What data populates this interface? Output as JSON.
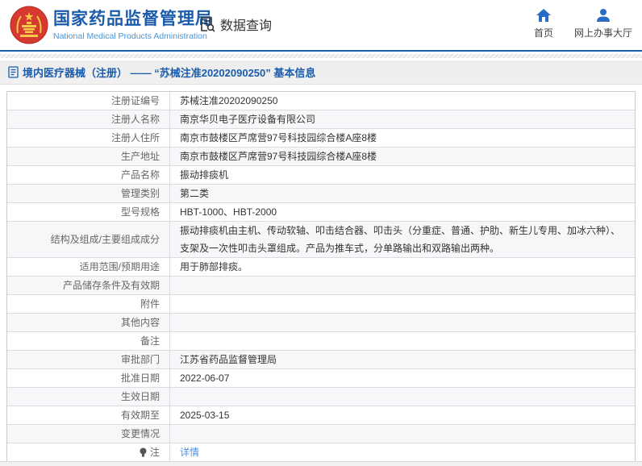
{
  "header": {
    "org_name_cn": "国家药品监督管理局",
    "org_name_en": "National Medical Products Administration",
    "data_query_label": "数据查询",
    "nav_home_label": "首页",
    "nav_hall_label": "网上办事大厅"
  },
  "breadcrumb": {
    "text": "境内医疗器械（注册） —— “苏械注准20202090250” 基本信息"
  },
  "colors": {
    "accent_blue": "#1a5cab",
    "icon_blue": "#2a6cc4",
    "link_blue": "#4a90e2",
    "emblem_red": "#d6392f",
    "emblem_gold": "#f7c948",
    "row_alt_bg": "#f7f7f9"
  },
  "table": {
    "rows": [
      {
        "label": "注册证编号",
        "value": "苏械注准20202090250"
      },
      {
        "label": "注册人名称",
        "value": "南京华贝电子医疗设备有限公司"
      },
      {
        "label": "注册人住所",
        "value": "南京市鼓楼区芦席营97号科技园综合楼A座8楼"
      },
      {
        "label": "生产地址",
        "value": "南京市鼓楼区芦席营97号科技园综合楼A座8楼"
      },
      {
        "label": "产品名称",
        "value": "振动排痰机"
      },
      {
        "label": "管理类别",
        "value": "第二类"
      },
      {
        "label": "型号规格",
        "value": "HBT-1000、HBT-2000"
      },
      {
        "label": "结构及组成/主要组成成分",
        "value": "振动排痰机由主机、传动软轴、叩击结合器、叩击头（分重症、普通、护肋、新生儿专用、加冰六种）、支架及一次性叩击头罩组成。产品为推车式，分单路输出和双路输出两种。"
      },
      {
        "label": "适用范围/预期用途",
        "value": "用于肺部排痰。"
      },
      {
        "label": "产品储存条件及有效期",
        "value": ""
      },
      {
        "label": "附件",
        "value": ""
      },
      {
        "label": "其他内容",
        "value": ""
      },
      {
        "label": "备注",
        "value": ""
      },
      {
        "label": "审批部门",
        "value": "江苏省药品监督管理局"
      },
      {
        "label": "批准日期",
        "value": "2022-06-07"
      },
      {
        "label": "生效日期",
        "value": ""
      },
      {
        "label": "有效期至",
        "value": "2025-03-15"
      },
      {
        "label": "变更情况",
        "value": ""
      },
      {
        "label": "注",
        "value": "详情",
        "link": true,
        "label_icon": "note-icon"
      }
    ]
  }
}
